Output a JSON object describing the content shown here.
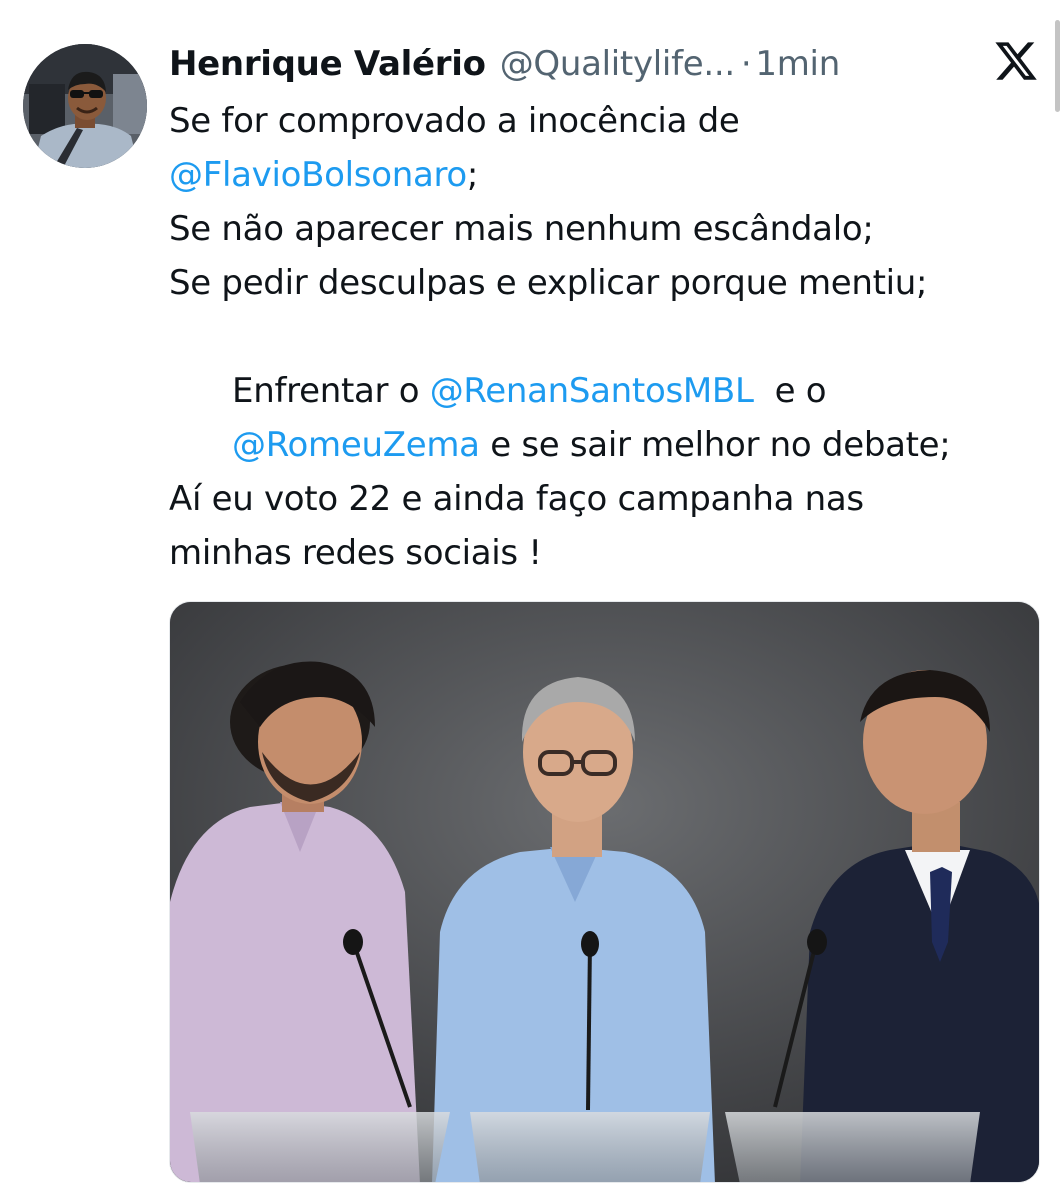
{
  "tweet": {
    "author": {
      "name": "Henrique Valério",
      "handle": "@Qualitylife...",
      "separator": "·",
      "timestamp": "1min",
      "avatar_icon": "profile-photo"
    },
    "platform_icon": "x-logo-icon",
    "lines": [
      {
        "text": "Se for comprovado a inocência de"
      },
      {
        "mention": "@FlavioBolsonaro",
        "after": ";"
      },
      {
        "text": "Se não aparecer mais nenhum escândalo;"
      },
      {
        "text": "Se pedir desculpas e explicar porque mentiu;"
      },
      {
        "before": "Enfrentar o ",
        "mention": "@RenanSantosMBL",
        "after": "  e o"
      },
      {
        "mention": "@RomeuZema",
        "after": " e se sair melhor no debate;"
      },
      {
        "text": "Aí eu voto 22 e ainda faço campanha nas"
      },
      {
        "text": "minhas redes sociais !"
      }
    ],
    "media": {
      "type": "photo",
      "icon": "debate-photo"
    }
  },
  "colors": {
    "text": "#0f1419",
    "secondary": "#536471",
    "mention": "#1d9bf0"
  }
}
